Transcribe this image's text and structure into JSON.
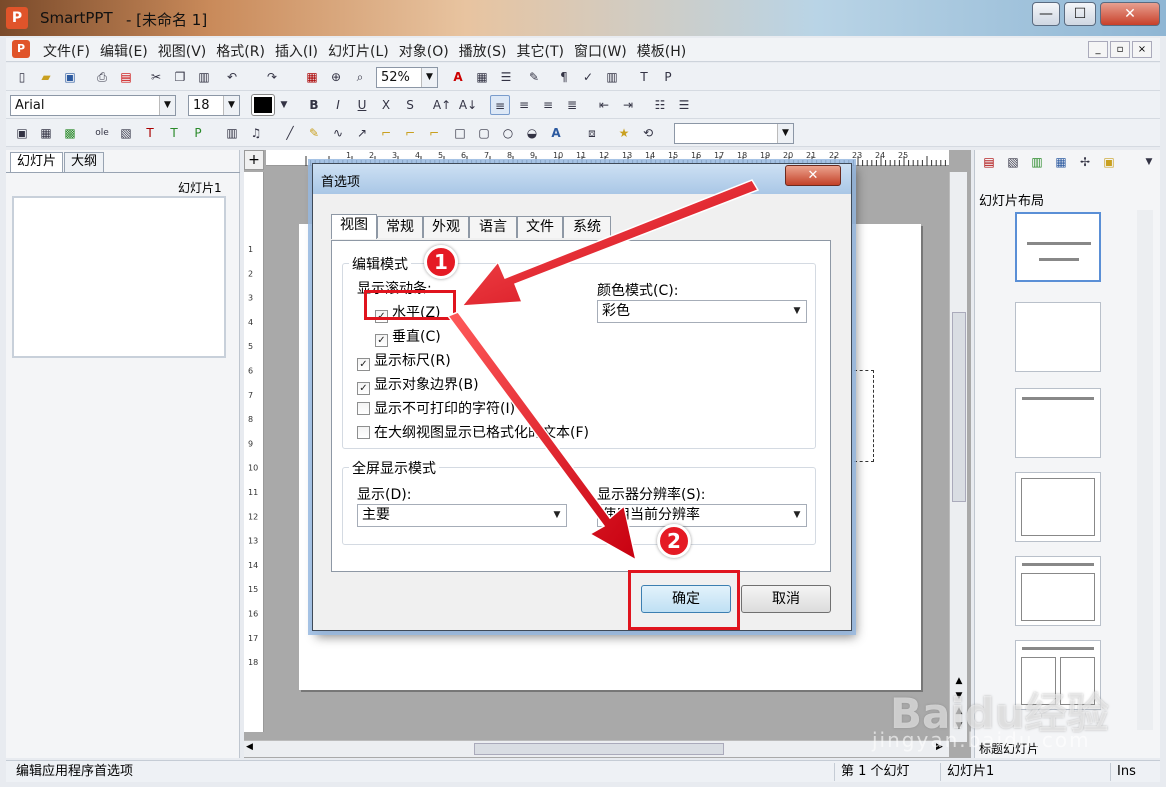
{
  "window": {
    "app_name": "SmartPPT",
    "doc_title": "- [未命名 1]",
    "min": "—",
    "max": "☐",
    "close": "✕"
  },
  "menu": {
    "items": [
      "文件(F)",
      "编辑(E)",
      "视图(V)",
      "格式(R)",
      "插入(I)",
      "幻灯片(L)",
      "对象(O)",
      "播放(S)",
      "其它(T)",
      "窗口(W)",
      "模板(H)"
    ]
  },
  "toolbar": {
    "zoom": "52%",
    "font": "Arial",
    "font_size": "18"
  },
  "left_panel": {
    "tab_slides": "幻灯片",
    "tab_outline": "大纲",
    "thumb_label": "幻灯片1"
  },
  "right_panel": {
    "title": "幻灯片布局",
    "bottom_label": "标题幻灯片"
  },
  "status": {
    "message": "编辑应用程序首选项",
    "slide_count": "第 1 个幻灯",
    "slide_name": "幻灯片1",
    "mode": "Ins"
  },
  "dialog": {
    "title": "首选项",
    "close": "✕",
    "tabs": [
      "视图",
      "常规",
      "外观",
      "语言",
      "文件",
      "系统"
    ],
    "edit_mode": {
      "title": "编辑模式",
      "scrollbars_label": "显示滚动条:",
      "horizontal": "水平(Z)",
      "vertical": "垂直(C)",
      "show_ruler": "显示标尺(R)",
      "show_bounds": "显示对象边界(B)",
      "show_nonprint": "显示不可打印的字符(I)",
      "outline_formatted": "在大纲视图显示已格式化的文本(F)",
      "color_mode_label": "颜色模式(C):",
      "color_mode_value": "彩色"
    },
    "fullscreen": {
      "title": "全屏显示模式",
      "display_label": "显示(D):",
      "display_value": "主要",
      "resolution_label": "显示器分辨率(S):",
      "resolution_value": "使用当前分辨率"
    },
    "ok": "确定",
    "cancel": "取消"
  },
  "annotations": {
    "badge1": "1",
    "badge2": "2"
  },
  "watermark": {
    "text": "Baidu经验",
    "url": "jingyan.baidu.com"
  }
}
